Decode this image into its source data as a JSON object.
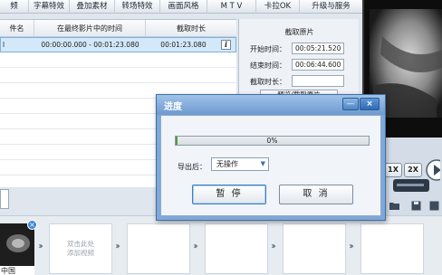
{
  "tabs": [
    "频",
    "字幕特效",
    "叠加素材",
    "转场特效",
    "画面风格",
    "M T V",
    "卡拉OK",
    "升级与服务"
  ],
  "list": {
    "headers": [
      "件名",
      "在最终影片中的时间",
      "截取时长"
    ],
    "rows": [
      {
        "name": "l",
        "time": "00:00:00.000 - 00:01:23.080",
        "duration": "00:01:23.080",
        "info": "i"
      }
    ]
  },
  "trim": {
    "title": "截取原片",
    "start_label": "开始时间：",
    "start_value": "00:05:21.520",
    "end_label": "结束时间：",
    "end_value": "00:06:44.600",
    "length_label": "截取时长：",
    "preview_button": "预览/截取原片"
  },
  "controls": {
    "speed_1x": "1X",
    "speed_2x": "2X"
  },
  "timeline": {
    "clip_label": "中国",
    "clip_close": "×",
    "slot_hint_line1": "双击此处",
    "slot_hint_line2": "添加视频"
  },
  "dialog": {
    "title": "进度",
    "minimize": "—",
    "close": "×",
    "progress_percent": 0,
    "progress_text": "0%",
    "after_export_label": "导出后：",
    "after_export_value": "无操作",
    "pause_button": "暂 停",
    "cancel_button": "取 消"
  },
  "colors": {
    "accent": "#3d86d8",
    "dialog_frame": "#7fa8d8",
    "progress": "#4f9e3e"
  }
}
